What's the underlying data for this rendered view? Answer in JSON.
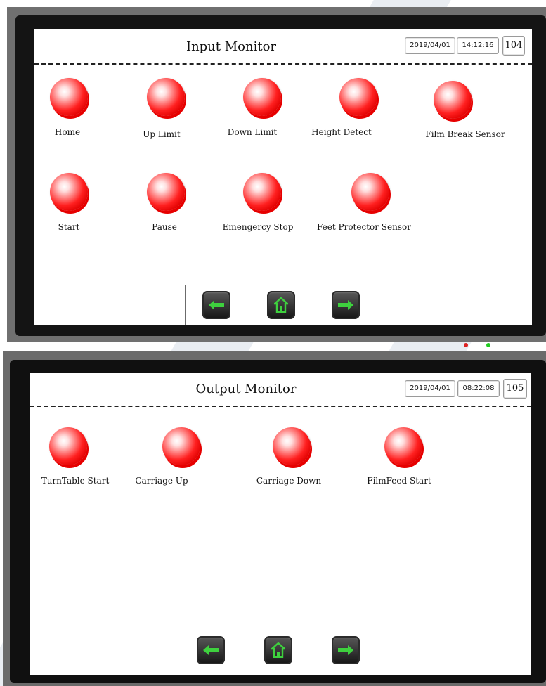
{
  "panels": [
    {
      "title": "Input Monitor",
      "date": "2019/04/01",
      "time": "14:12:16",
      "screen_number": "104",
      "indicators": [
        {
          "label": "Home",
          "state": "off"
        },
        {
          "label": "Up Limit",
          "state": "off"
        },
        {
          "label": "Down Limit",
          "state": "off"
        },
        {
          "label": "Height Detect",
          "state": "off"
        },
        {
          "label": "Film Break Sensor",
          "state": "off"
        },
        {
          "label": "Start",
          "state": "off"
        },
        {
          "label": "Pause",
          "state": "off"
        },
        {
          "label": "Emengercy Stop",
          "state": "off"
        },
        {
          "label": "Feet Protector Sensor",
          "state": "off"
        }
      ],
      "nav_icons": [
        "back-arrow-icon",
        "home-icon",
        "forward-arrow-icon"
      ]
    },
    {
      "title": "Output Monitor",
      "date": "2019/04/01",
      "time": "08:22:08",
      "screen_number": "105",
      "indicators": [
        {
          "label": "TurnTable Start",
          "state": "off"
        },
        {
          "label": "Carriage Up",
          "state": "off"
        },
        {
          "label": "Carriage Down",
          "state": "off"
        },
        {
          "label": "FilmFeed Start",
          "state": "off"
        }
      ],
      "nav_icons": [
        "back-arrow-icon",
        "home-icon",
        "forward-arrow-icon"
      ]
    }
  ],
  "colors": {
    "lamp_red": "#ff2020",
    "nav_icon_green": "#3ed13e",
    "bezel_gray": "#707070",
    "frame_black": "#141414"
  }
}
